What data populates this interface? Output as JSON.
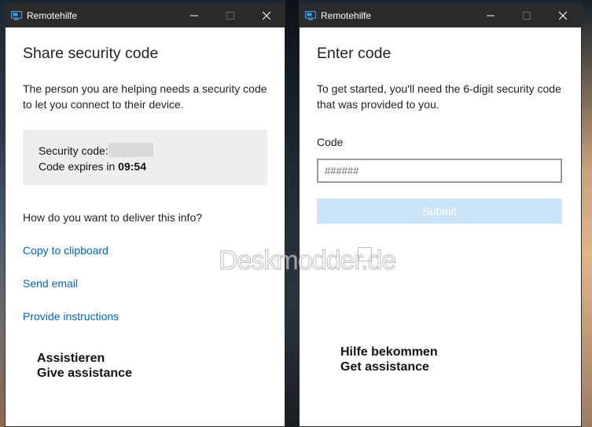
{
  "left_window": {
    "title": "Remotehilfe",
    "heading": "Share security code",
    "description": "The person you are helping needs a security code to let you connect to their device.",
    "security_code_label": "Security code:",
    "expires_label": "Code expires in ",
    "expires_value": "09:54",
    "question": "How do you want to deliver this info?",
    "links": [
      "Copy to clipboard",
      "Send email",
      "Provide instructions"
    ],
    "caption_line1": "Assistieren",
    "caption_line2": "Give assistance"
  },
  "right_window": {
    "title": "Remotehilfe",
    "heading": "Enter code",
    "description": "To get started, you'll need the 6-digit security code that was provided to you.",
    "code_label": "Code",
    "code_placeholder": "######",
    "submit_label": "Submit",
    "caption_line1": "Hilfe bekommen",
    "caption_line2": "Get assistance"
  },
  "watermark": "Deskmodder.de",
  "colors": {
    "titlebar": "#2b2b2b",
    "link": "#0067b8",
    "submit_disabled": "#cce4f7",
    "code_box": "#eeeeee"
  },
  "icons": [
    "remote-assistance-app-icon",
    "minimize-icon",
    "maximize-icon",
    "close-icon"
  ]
}
